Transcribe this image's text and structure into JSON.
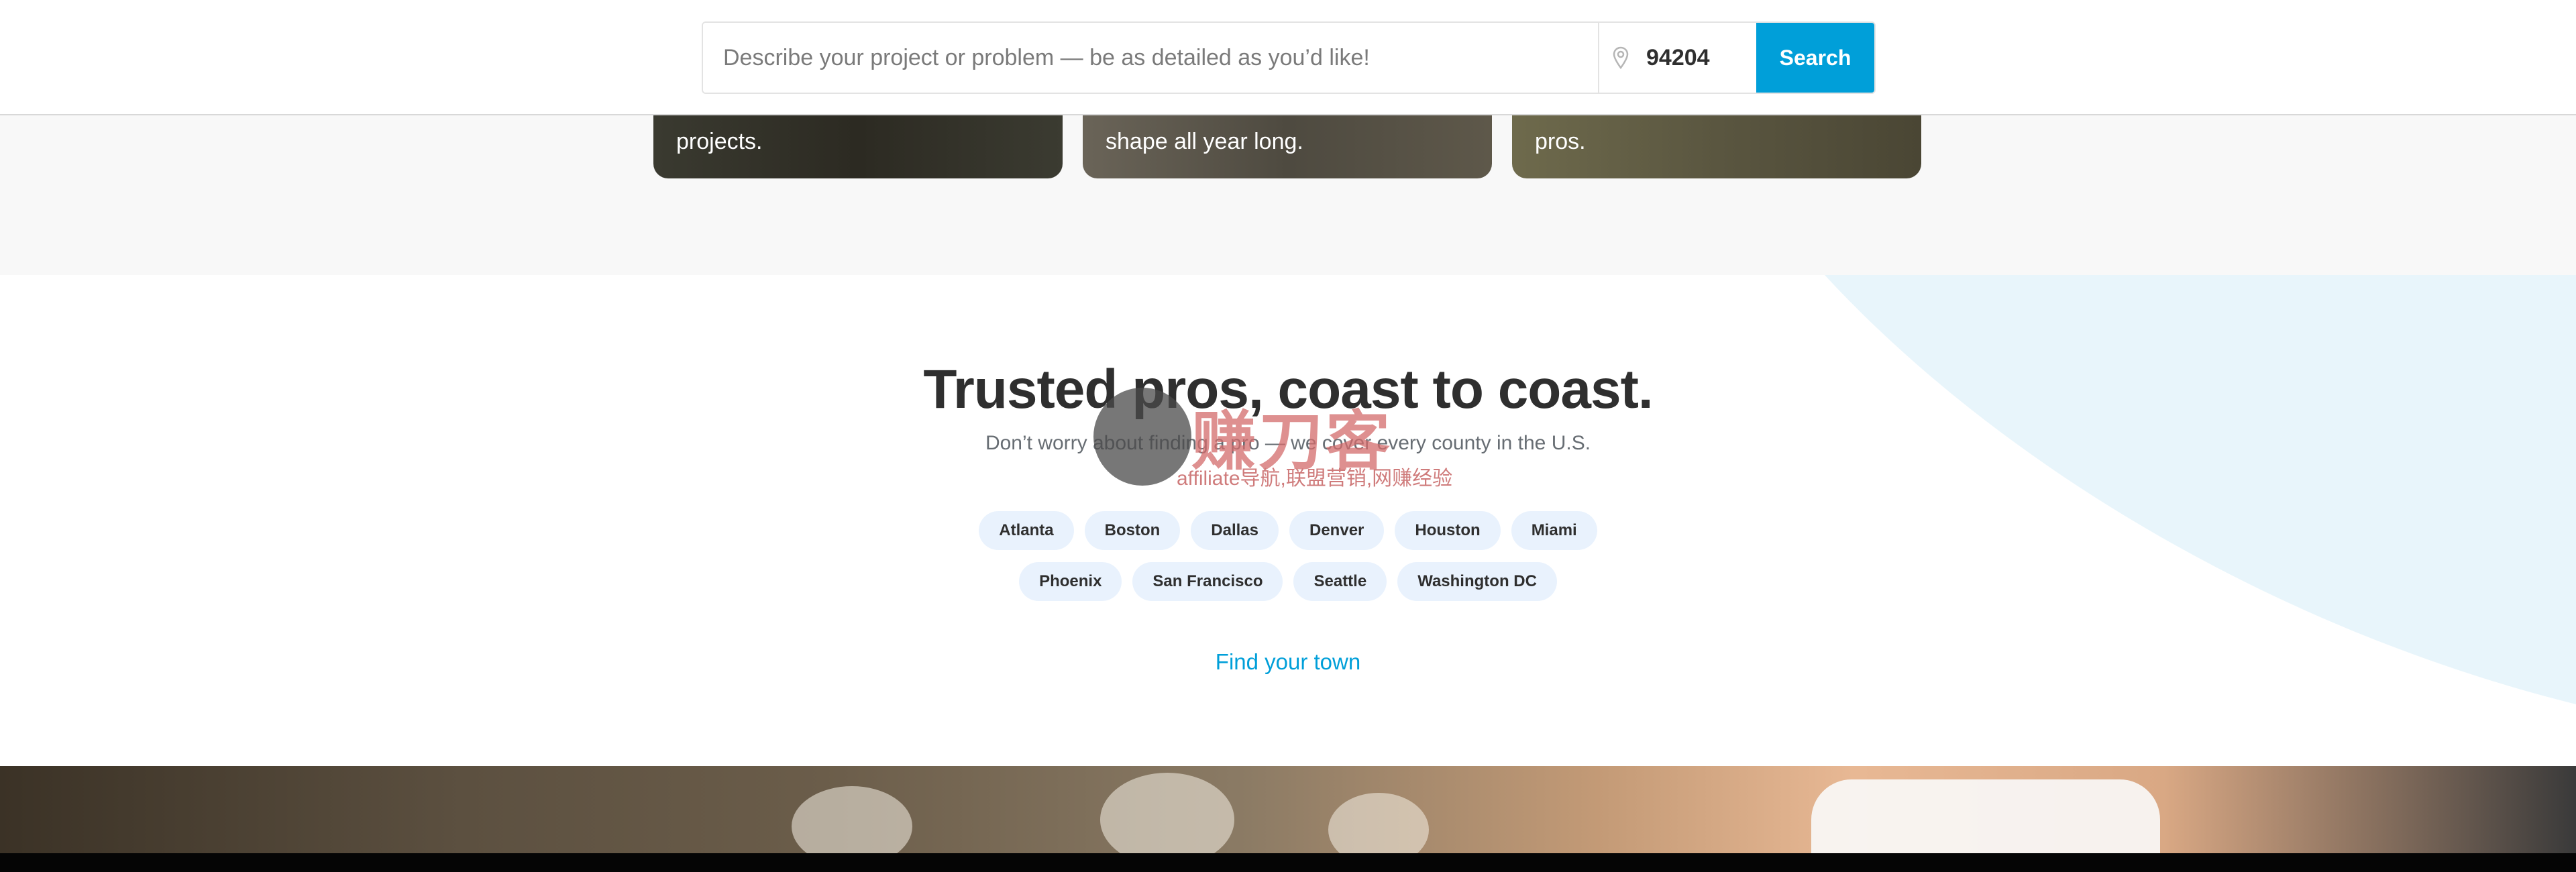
{
  "header": {
    "search_placeholder": "Describe your project or problem — be as detailed as you’d like!",
    "zip_value": "94204",
    "search_button_label": "Search"
  },
  "cards": [
    {
      "text": "projects."
    },
    {
      "text": "shape all year long."
    },
    {
      "text": "pros."
    }
  ],
  "trusted": {
    "title": "Trusted pros, coast to coast.",
    "subtitle": "Don’t worry about finding a pro — we cover every county in the U.S.",
    "cities_row1": [
      "Atlanta",
      "Boston",
      "Dallas",
      "Denver",
      "Houston",
      "Miami"
    ],
    "cities_row2": [
      "Phoenix",
      "San Francisco",
      "Seattle",
      "Washington DC"
    ],
    "find_town_link": "Find your town"
  },
  "watermark": {
    "title": "赚刀客",
    "subtitle": "affiliate导航,联盟营销,网赚经验"
  },
  "colors": {
    "accent": "#009fd9",
    "chip_bg": "#e9f2fd",
    "band_bg": "#f8f8f8",
    "curve_bg": "#e8f5fb"
  }
}
